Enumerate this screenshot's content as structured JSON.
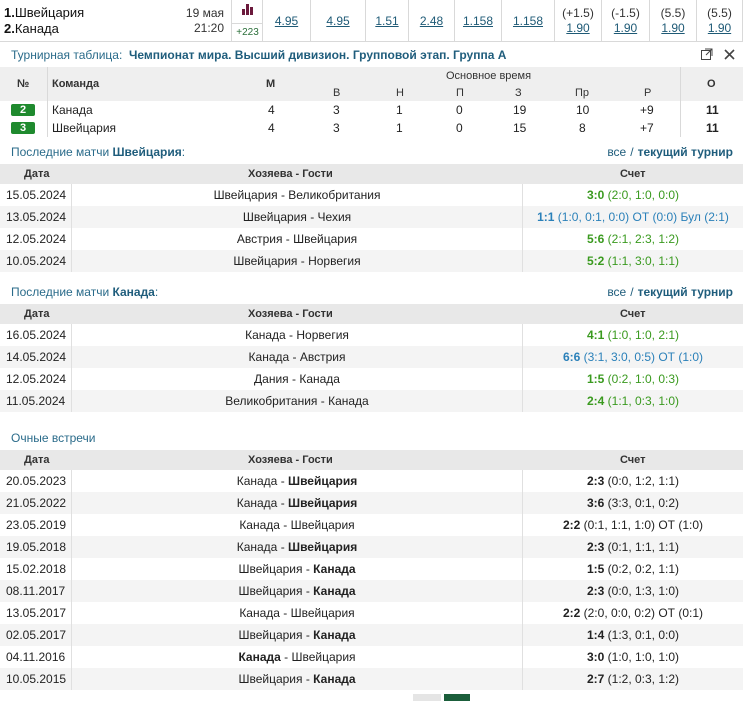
{
  "event": {
    "team1_num": "1.",
    "team1_name": "Швейцария",
    "team2_num": "2.",
    "team2_name": "Канада",
    "date": "19 мая",
    "time": "21:20",
    "more_markets": "+223",
    "odds": [
      {
        "header": "",
        "value": "4.95"
      },
      {
        "header": "",
        "value": "4.95"
      },
      {
        "header": "",
        "value": "1.51"
      },
      {
        "header": "",
        "value": "2.48"
      },
      {
        "header": "",
        "value": "1.158"
      },
      {
        "header": "",
        "value": "1.158"
      },
      {
        "header": "(+1.5)",
        "value": "1.90"
      },
      {
        "header": "(-1.5)",
        "value": "1.90"
      },
      {
        "header": "(5.5)",
        "value": "1.90"
      },
      {
        "header": "(5.5)",
        "value": "1.90"
      }
    ]
  },
  "standings": {
    "label": "Турнирная таблица:",
    "tournament": "Чемпионат мира. Высший дивизион. Групповой этап. Группа A",
    "headers": {
      "pos": "№",
      "team": "Команда",
      "games": "М",
      "main_time": "Основное время",
      "wins": "В",
      "draws": "Н",
      "ot": "П",
      "goals_for": "З",
      "goals_against": "Пр",
      "diff": "Р",
      "points": "О"
    },
    "rows": [
      {
        "pos": "2",
        "team": "Канада",
        "games": "4",
        "wins": "3",
        "draws": "1",
        "ot": "0",
        "gf": "19",
        "ga": "10",
        "diff": "+9",
        "pts": "11"
      },
      {
        "pos": "3",
        "team": "Швейцария",
        "games": "4",
        "wins": "3",
        "draws": "1",
        "ot": "0",
        "gf": "15",
        "ga": "8",
        "diff": "+7",
        "pts": "11"
      }
    ]
  },
  "links": {
    "all": "все",
    "sep": "/",
    "current": "текущий турнир"
  },
  "table_headers": {
    "date": "Дата",
    "teams": "Хозяева - Гости",
    "score": "Счет"
  },
  "swiss_section": {
    "prefix": "Последние матчи ",
    "team": "Швейцария",
    "suffix": ":",
    "rows": [
      {
        "date": "15.05.2024",
        "home": "Швейцария",
        "away": "Великобритания",
        "bold": "",
        "score": "3:0",
        "detail": "(2:0, 1:0, 0:0)",
        "kind": "win"
      },
      {
        "date": "13.05.2024",
        "home": "Швейцария",
        "away": "Чехия",
        "bold": "",
        "score": "1:1",
        "detail": "(1:0, 0:1, 0:0) ОТ (0:0) Бул (2:1)",
        "kind": "ot"
      },
      {
        "date": "12.05.2024",
        "home": "Австрия",
        "away": "Швейцария",
        "bold": "",
        "score": "5:6",
        "detail": "(2:1, 2:3, 1:2)",
        "kind": "win"
      },
      {
        "date": "10.05.2024",
        "home": "Швейцария",
        "away": "Норвегия",
        "bold": "",
        "score": "5:2",
        "detail": "(1:1, 3:0, 1:1)",
        "kind": "win"
      }
    ]
  },
  "canada_section": {
    "prefix": "Последние матчи ",
    "team": "Канада",
    "suffix": ":",
    "rows": [
      {
        "date": "16.05.2024",
        "home": "Канада",
        "away": "Норвегия",
        "bold": "",
        "score": "4:1",
        "detail": "(1:0, 1:0, 2:1)",
        "kind": "win"
      },
      {
        "date": "14.05.2024",
        "home": "Канада",
        "away": "Австрия",
        "bold": "",
        "score": "6:6",
        "detail": "(3:1, 3:0, 0:5) ОТ (1:0)",
        "kind": "ot"
      },
      {
        "date": "12.05.2024",
        "home": "Дания",
        "away": "Канада",
        "bold": "",
        "score": "1:5",
        "detail": "(0:2, 1:0, 0:3)",
        "kind": "win"
      },
      {
        "date": "11.05.2024",
        "home": "Великобритания",
        "away": "Канада",
        "bold": "",
        "score": "2:4",
        "detail": "(1:1, 0:3, 1:0)",
        "kind": "win"
      }
    ]
  },
  "h2h_section": {
    "title": "Очные встречи",
    "rows": [
      {
        "date": "20.05.2023",
        "home": "Канада",
        "away": "Швейцария",
        "bold": "away",
        "score": "2:3",
        "detail": "(0:0, 1:2, 1:1)",
        "kind": "loss"
      },
      {
        "date": "21.05.2022",
        "home": "Канада",
        "away": "Швейцария",
        "bold": "away",
        "score": "3:6",
        "detail": "(3:3, 0:1, 0:2)",
        "kind": "loss"
      },
      {
        "date": "23.05.2019",
        "home": "Канада",
        "away": "Швейцария",
        "bold": "",
        "score": "2:2",
        "detail": "(0:1, 1:1, 1:0) ОТ (1:0)",
        "kind": "loss"
      },
      {
        "date": "19.05.2018",
        "home": "Канада",
        "away": "Швейцария",
        "bold": "away",
        "score": "2:3",
        "detail": "(0:1, 1:1, 1:1)",
        "kind": "loss"
      },
      {
        "date": "15.02.2018",
        "home": "Швейцария",
        "away": "Канада",
        "bold": "away",
        "score": "1:5",
        "detail": "(0:2, 0:2, 1:1)",
        "kind": "loss"
      },
      {
        "date": "08.11.2017",
        "home": "Швейцария",
        "away": "Канада",
        "bold": "away",
        "score": "2:3",
        "detail": "(0:0, 1:3, 1:0)",
        "kind": "loss"
      },
      {
        "date": "13.05.2017",
        "home": "Канада",
        "away": "Швейцария",
        "bold": "",
        "score": "2:2",
        "detail": "(2:0, 0:0, 0:2) ОТ (0:1)",
        "kind": "loss"
      },
      {
        "date": "02.05.2017",
        "home": "Швейцария",
        "away": "Канада",
        "bold": "away",
        "score": "1:4",
        "detail": "(1:3, 0:1, 0:0)",
        "kind": "loss"
      },
      {
        "date": "04.11.2016",
        "home": "Канада",
        "away": "Швейцария",
        "bold": "home",
        "score": "3:0",
        "detail": "(1:0, 1:0, 1:0)",
        "kind": "loss"
      },
      {
        "date": "10.05.2015",
        "home": "Швейцария",
        "away": "Канада",
        "bold": "away",
        "score": "2:7",
        "detail": "(1:2, 0:3, 1:2)",
        "kind": "loss"
      }
    ]
  },
  "icons": {
    "stats": "bar-chart-icon",
    "popout": "popout-window-icon",
    "close": "close-icon"
  },
  "colors": {
    "badge_green": "#1f8a2e",
    "win_green": "#3a9a1f",
    "ot_blue": "#2a80b9",
    "link_blue": "#1f5d7c"
  }
}
